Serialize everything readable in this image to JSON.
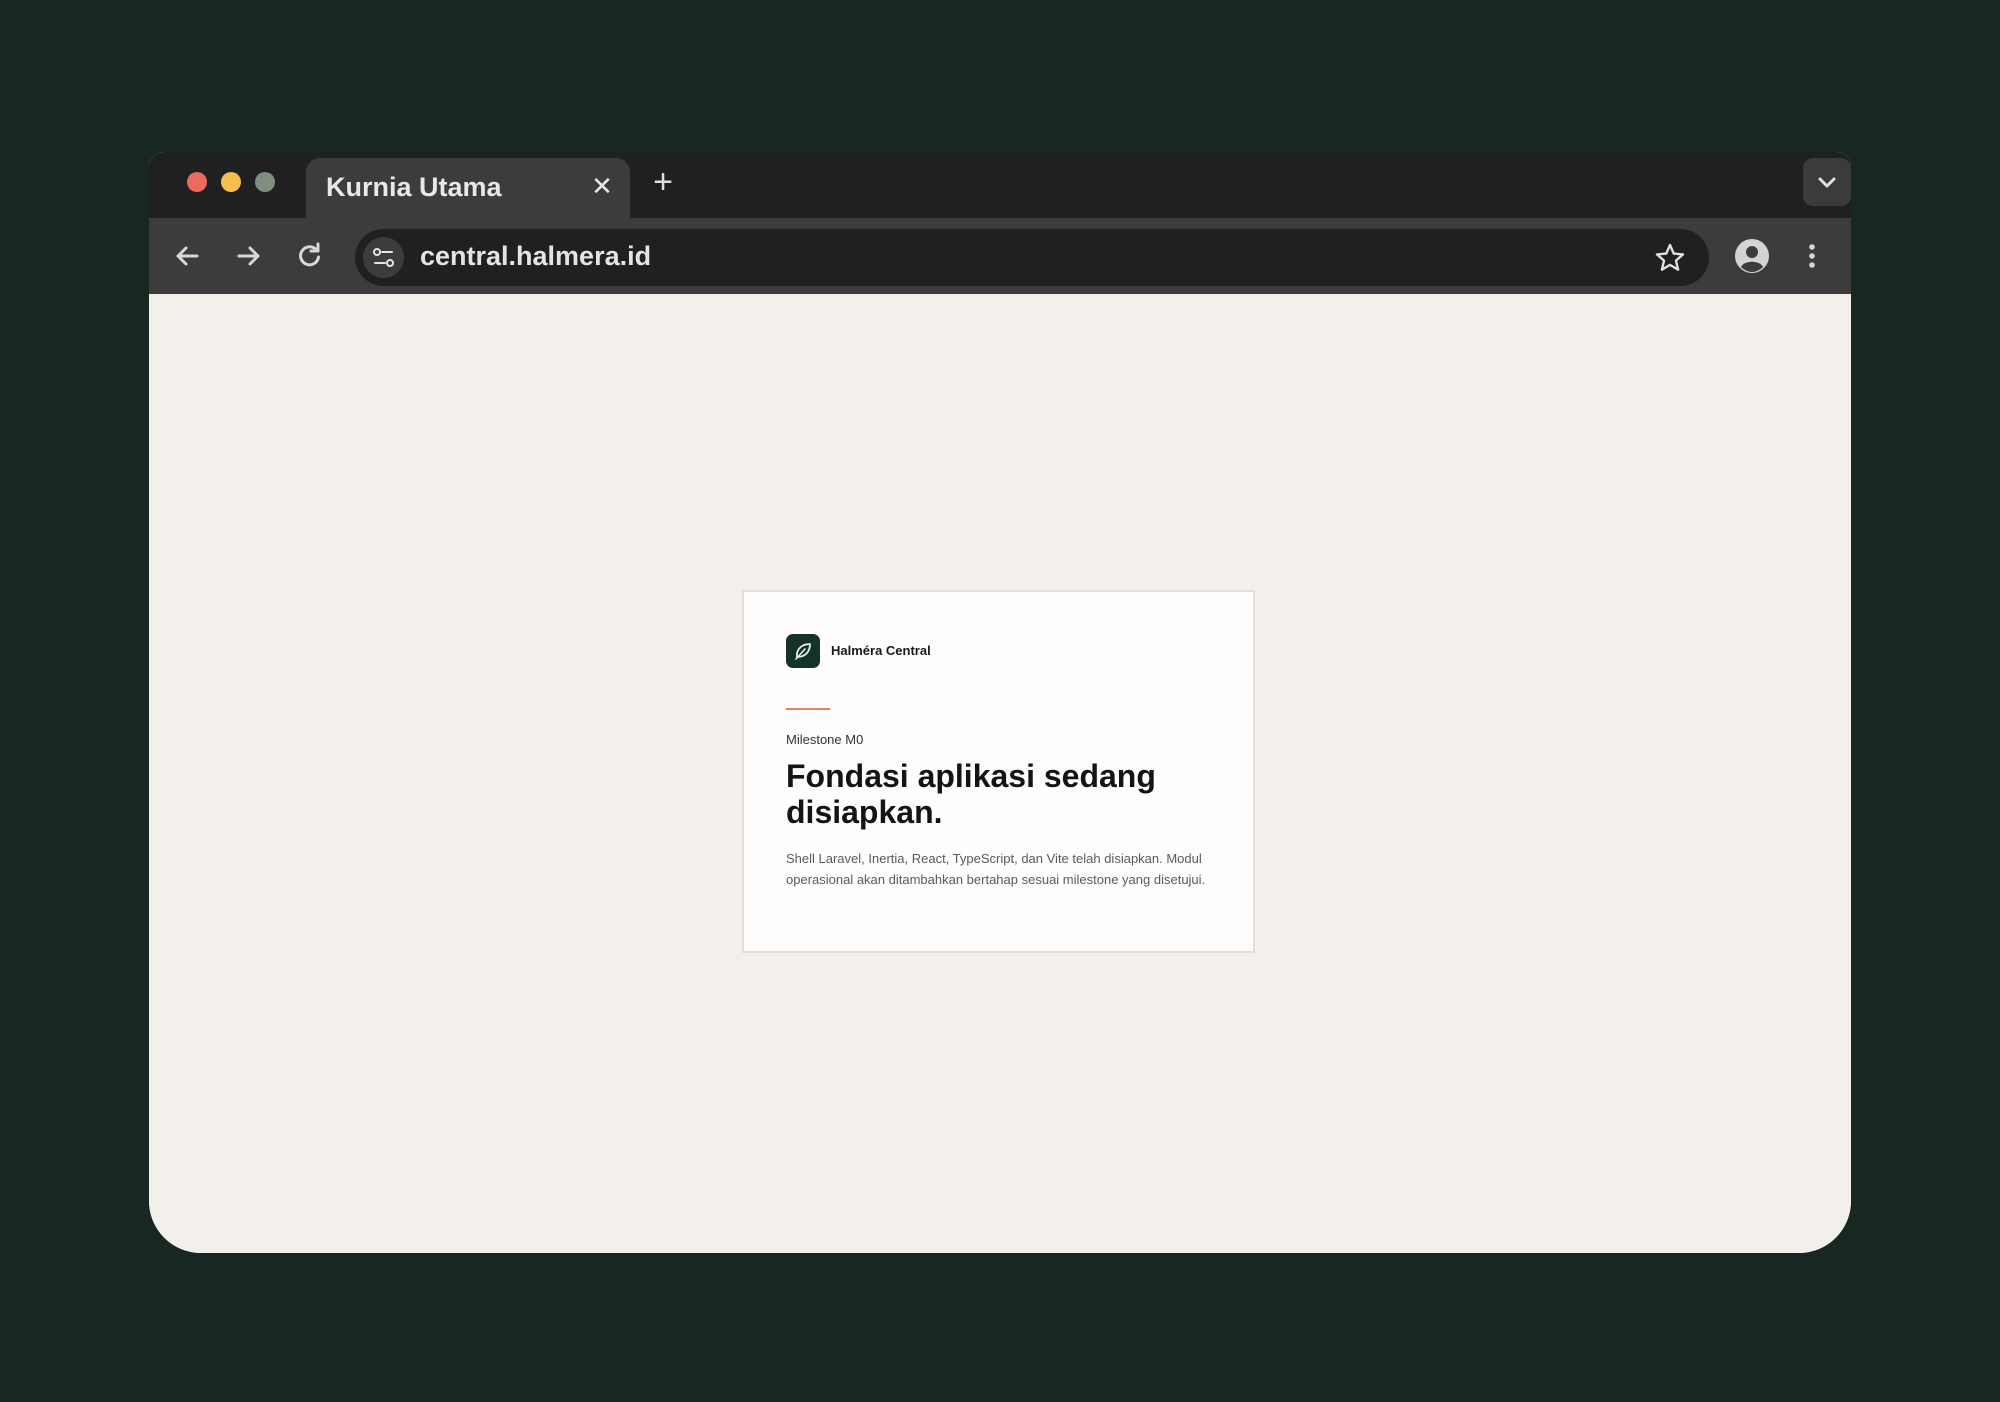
{
  "browser": {
    "tab": {
      "title": "Kurnia Utama",
      "close_glyph": "✕"
    },
    "new_tab_glyph": "+",
    "address": {
      "url": "central.halmera.id"
    },
    "icons": {
      "back": "arrow-left-icon",
      "forward": "arrow-right-icon",
      "reload": "reload-icon",
      "site_info": "tune-icon",
      "bookmark": "star-icon",
      "profile": "account-circle-icon",
      "menu": "more-vert-icon",
      "tab_search": "chevron-down-icon"
    },
    "colors": {
      "traffic_close": "#ec6a5e",
      "traffic_minimize": "#f4bf4f",
      "traffic_maximize": "#7e8f7d"
    }
  },
  "page": {
    "brand": {
      "name": "Halméra Central",
      "logo_icon": "leaf-icon",
      "logo_color": "#12322a"
    },
    "accent_color": "#e0806f",
    "milestone": "Milestone M0",
    "headline": "Fondasi aplikasi sedang disiapkan.",
    "description": "Shell Laravel, Inertia, React, TypeScript, dan Vite telah disiapkan. Modul operasional akan ditambahkan bertahap sesuai milestone yang disetujui."
  }
}
